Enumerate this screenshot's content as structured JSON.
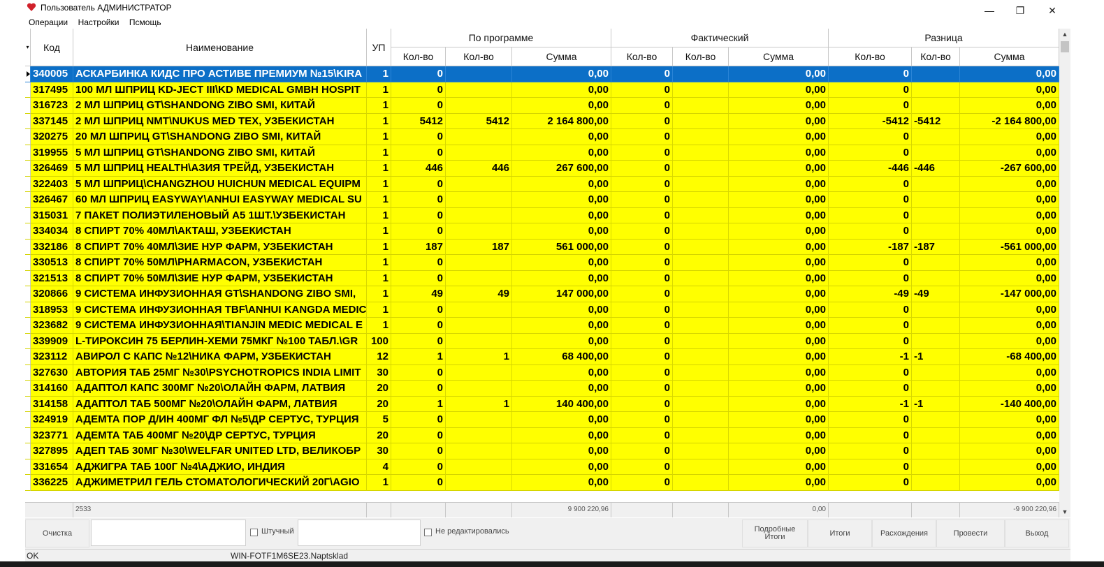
{
  "window": {
    "title": "Пользователь АДМИНИСТРАТОР",
    "minimize": "—",
    "maximize": "❐",
    "close": "✕"
  },
  "menu": [
    "Операции",
    "Настройки",
    "Псмощь"
  ],
  "headers": {
    "code": "Код",
    "name": "Наименование",
    "up": "УП",
    "program": "По программе",
    "actual": "Фактический",
    "diff": "Разница",
    "qty": "Кол-во",
    "sum": "Сумма"
  },
  "rows": [
    [
      "340005",
      "АСКАРБИНКА КИДС ПРО АСТИВЕ ПРЕМИУМ №15\\KIRA",
      "1",
      "0",
      "",
      "0,00",
      "0",
      "",
      "0,00",
      "0",
      "",
      "0,00"
    ],
    [
      "317495",
      "100 МЛ ШПРИЦ KD-JECT III\\KD MEDICAL GMBH HOSPIT",
      "1",
      "0",
      "",
      "0,00",
      "0",
      "",
      "0,00",
      "0",
      "",
      "0,00"
    ],
    [
      "316723",
      "2 МЛ ШПРИЦ GT\\SHANDONG ZIBO SMI, КИТАЙ",
      "1",
      "0",
      "",
      "0,00",
      "0",
      "",
      "0,00",
      "0",
      "",
      "0,00"
    ],
    [
      "337145",
      "2 МЛ ШПРИЦ NMT\\NUKUS MED TEX, УЗБЕКИСТАН",
      "1",
      "5412",
      "5412",
      "2 164 800,00",
      "0",
      "",
      "0,00",
      "-5412",
      "-5412",
      "-2 164 800,00"
    ],
    [
      "320275",
      "20 МЛ ШПРИЦ GT\\SHANDONG ZIBO SMI, КИТАЙ",
      "1",
      "0",
      "",
      "0,00",
      "0",
      "",
      "0,00",
      "0",
      "",
      "0,00"
    ],
    [
      "319955",
      "5 МЛ ШПРИЦ GT\\SHANDONG ZIBO SMI, КИТАЙ",
      "1",
      "0",
      "",
      "0,00",
      "0",
      "",
      "0,00",
      "0",
      "",
      "0,00"
    ],
    [
      "326469",
      "5 МЛ ШПРИЦ HEALTH\\АЗИЯ ТРЕЙД, УЗБЕКИСТАН",
      "1",
      "446",
      "446",
      "267 600,00",
      "0",
      "",
      "0,00",
      "-446",
      "-446",
      "-267 600,00"
    ],
    [
      "322403",
      "5 МЛ ШПРИЦ\\CHANGZHOU HUICHUN MEDICAL EQUIPM",
      "1",
      "0",
      "",
      "0,00",
      "0",
      "",
      "0,00",
      "0",
      "",
      "0,00"
    ],
    [
      "326467",
      "60 МЛ ШПРИЦ EASYWAY\\ANHUI EASYWAY MEDICAL SU",
      "1",
      "0",
      "",
      "0,00",
      "0",
      "",
      "0,00",
      "0",
      "",
      "0,00"
    ],
    [
      "315031",
      "7 ПАКЕТ ПОЛИЭТИЛЕНОВЫЙ А5 1ШТ.\\УЗБЕКИСТАН",
      "1",
      "0",
      "",
      "0,00",
      "0",
      "",
      "0,00",
      "0",
      "",
      "0,00"
    ],
    [
      "334034",
      "8 СПИРТ 70% 40МЛ\\АКТАШ, УЗБЕКИСТАН",
      "1",
      "0",
      "",
      "0,00",
      "0",
      "",
      "0,00",
      "0",
      "",
      "0,00"
    ],
    [
      "332186",
      "8 СПИРТ 70% 40МЛ\\ЗИЕ НУР ФАРМ, УЗБЕКИСТАН",
      "1",
      "187",
      "187",
      "561 000,00",
      "0",
      "",
      "0,00",
      "-187",
      "-187",
      "-561 000,00"
    ],
    [
      "330513",
      "8 СПИРТ 70% 50МЛ\\PHARMACON, УЗБЕКИСТАН",
      "1",
      "0",
      "",
      "0,00",
      "0",
      "",
      "0,00",
      "0",
      "",
      "0,00"
    ],
    [
      "321513",
      "8 СПИРТ 70% 50МЛ\\ЗИЕ НУР ФАРМ, УЗБЕКИСТАН",
      "1",
      "0",
      "",
      "0,00",
      "0",
      "",
      "0,00",
      "0",
      "",
      "0,00"
    ],
    [
      "320866",
      "9 СИСТЕМА ИНФУЗИОННАЯ GT\\SHANDONG ZIBO SMI,",
      "1",
      "49",
      "49",
      "147 000,00",
      "0",
      "",
      "0,00",
      "-49",
      "-49",
      "-147 000,00"
    ],
    [
      "318953",
      "9 СИСТЕМА ИНФУЗИОННАЯ TBF\\ANHUI KANGDA MEDIC",
      "1",
      "0",
      "",
      "0,00",
      "0",
      "",
      "0,00",
      "0",
      "",
      "0,00"
    ],
    [
      "323682",
      "9 СИСТЕМА ИНФУЗИОННАЯ\\TIANJIN MEDIC MEDICAL E",
      "1",
      "0",
      "",
      "0,00",
      "0",
      "",
      "0,00",
      "0",
      "",
      "0,00"
    ],
    [
      "339909",
      "L-ТИРОКСИН 75 БЕРЛИН-ХЕМИ 75МКГ №100 ТАБЛ.\\GR",
      "100",
      "0",
      "",
      "0,00",
      "0",
      "",
      "0,00",
      "0",
      "",
      "0,00"
    ],
    [
      "323112",
      "АВИРОЛ С КАПС №12\\НИКА ФАРМ, УЗБЕКИСТАН",
      "12",
      "1",
      "1",
      "68 400,00",
      "0",
      "",
      "0,00",
      "-1",
      "-1",
      "-68 400,00"
    ],
    [
      "327630",
      "АВТОРИЯ ТАБ 25МГ №30\\PSYCHOTROPICS INDIA LIMIT",
      "30",
      "0",
      "",
      "0,00",
      "0",
      "",
      "0,00",
      "0",
      "",
      "0,00"
    ],
    [
      "314160",
      "АДАПТОЛ КАПС 300МГ №20\\ОЛАЙН ФАРМ, ЛАТВИЯ",
      "20",
      "0",
      "",
      "0,00",
      "0",
      "",
      "0,00",
      "0",
      "",
      "0,00"
    ],
    [
      "314158",
      "АДАПТОЛ ТАБ 500МГ №20\\ОЛАЙН ФАРМ, ЛАТВИЯ",
      "20",
      "1",
      "1",
      "140 400,00",
      "0",
      "",
      "0,00",
      "-1",
      "-1",
      "-140 400,00"
    ],
    [
      "324919",
      "АДЕМТА ПОР Д/ИН 400МГ ФЛ №5\\ДР СЕРТУС, ТУРЦИЯ",
      "5",
      "0",
      "",
      "0,00",
      "0",
      "",
      "0,00",
      "0",
      "",
      "0,00"
    ],
    [
      "323771",
      "АДЕМТА ТАБ 400МГ №20\\ДР СЕРТУС, ТУРЦИЯ",
      "20",
      "0",
      "",
      "0,00",
      "0",
      "",
      "0,00",
      "0",
      "",
      "0,00"
    ],
    [
      "327895",
      "АДЕП ТАБ 30МГ №30\\WELFAR UNITED LTD, ВЕЛИКОБР",
      "30",
      "0",
      "",
      "0,00",
      "0",
      "",
      "0,00",
      "0",
      "",
      "0,00"
    ],
    [
      "331654",
      "АДЖИГРА ТАБ 100Г №4\\АДЖИО, ИНДИЯ",
      "4",
      "0",
      "",
      "0,00",
      "0",
      "",
      "0,00",
      "0",
      "",
      "0,00"
    ],
    [
      "336225",
      "АДЖИМЕТРИЛ ГЕЛЬ СТОМАТОЛОГИЧЕСКИЙ 20Г\\AGIO",
      "1",
      "0",
      "",
      "0,00",
      "0",
      "",
      "0,00",
      "0",
      "",
      "0,00"
    ]
  ],
  "totals": {
    "count": "2533",
    "program_sum": "9 900 220,96",
    "actual_sum": "0,00",
    "diff_sum": "-9 900 220,96"
  },
  "bottom": {
    "clear": "Очистка",
    "piece_label": "Штучный",
    "not_edited_label": "Не редактировались",
    "detailed_totals": "Подробные Итоги",
    "totals": "Итоги",
    "discrepancies": "Расхождения",
    "post": "Провести",
    "exit": "Выход"
  },
  "status": {
    "state": "OK",
    "connection": "WIN-FOTF1M6SE23.Naptsklad"
  },
  "colors": {
    "row_bg": "#ffff00",
    "selected_bg": "#0c6fc7"
  }
}
